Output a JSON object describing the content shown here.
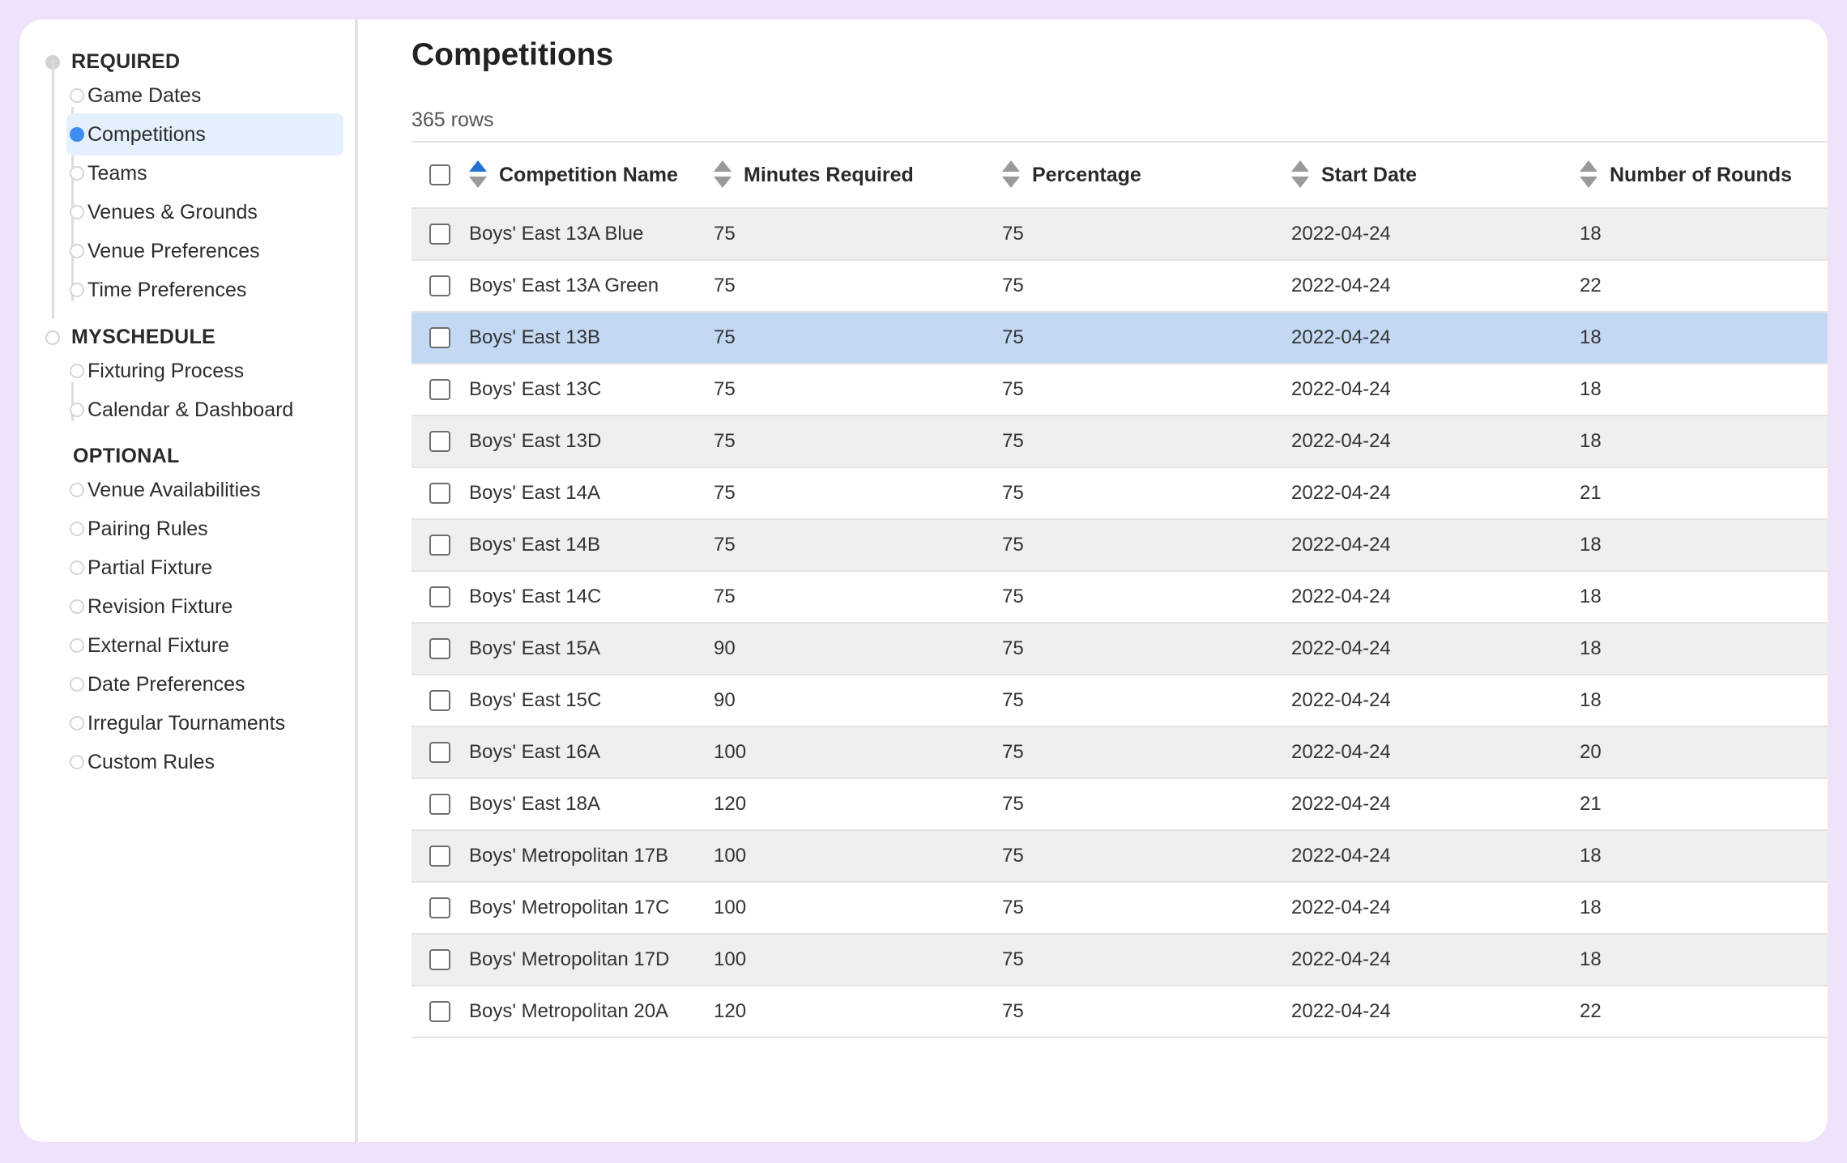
{
  "sidebar": {
    "sections": [
      {
        "heading": "REQUIRED",
        "items": [
          "Game Dates",
          "Competitions",
          "Teams",
          "Venues & Grounds",
          "Venue Preferences",
          "Time Preferences"
        ]
      },
      {
        "heading": "MYSCHEDULE",
        "items": [
          "Fixturing Process",
          "Calendar & Dashboard"
        ]
      },
      {
        "heading": "OPTIONAL",
        "items": [
          "Venue Availabilities",
          "Pairing Rules",
          "Partial Fixture",
          "Revision Fixture",
          "External Fixture",
          "Date Preferences",
          "Irregular Tournaments",
          "Custom Rules"
        ]
      }
    ],
    "active_item": "Competitions"
  },
  "main": {
    "title": "Competitions",
    "row_count": "365 rows",
    "columns": [
      "Competition Name",
      "Minutes Required",
      "Percentage",
      "Start Date",
      "Number of Rounds"
    ],
    "sorted_column": "Competition Name",
    "selected_row": "Boys' East 13B",
    "rows": [
      [
        "Boys' East 13A Blue",
        "75",
        "75",
        "2022-04-24",
        "18"
      ],
      [
        "Boys' East 13A Green",
        "75",
        "75",
        "2022-04-24",
        "22"
      ],
      [
        "Boys' East 13B",
        "75",
        "75",
        "2022-04-24",
        "18"
      ],
      [
        "Boys' East 13C",
        "75",
        "75",
        "2022-04-24",
        "18"
      ],
      [
        "Boys' East 13D",
        "75",
        "75",
        "2022-04-24",
        "18"
      ],
      [
        "Boys' East 14A",
        "75",
        "75",
        "2022-04-24",
        "21"
      ],
      [
        "Boys' East 14B",
        "75",
        "75",
        "2022-04-24",
        "18"
      ],
      [
        "Boys' East 14C",
        "75",
        "75",
        "2022-04-24",
        "18"
      ],
      [
        "Boys' East 15A",
        "90",
        "75",
        "2022-04-24",
        "18"
      ],
      [
        "Boys' East 15C",
        "90",
        "75",
        "2022-04-24",
        "18"
      ],
      [
        "Boys' East 16A",
        "100",
        "75",
        "2022-04-24",
        "20"
      ],
      [
        "Boys' East 18A",
        "120",
        "75",
        "2022-04-24",
        "21"
      ],
      [
        "Boys' Metropolitan 17B",
        "100",
        "75",
        "2022-04-24",
        "18"
      ],
      [
        "Boys' Metropolitan 17C",
        "100",
        "75",
        "2022-04-24",
        "18"
      ],
      [
        "Boys' Metropolitan 17D",
        "100",
        "75",
        "2022-04-24",
        "18"
      ],
      [
        "Boys' Metropolitan 20A",
        "120",
        "75",
        "2022-04-24",
        "22"
      ]
    ]
  },
  "colors": {
    "accent": "#3d8ef0",
    "sort_active": "#2173d0",
    "selected_row": "#c3d8f3",
    "active_nav_bg": "#e4f0fd",
    "frame": "#efe3fb"
  }
}
